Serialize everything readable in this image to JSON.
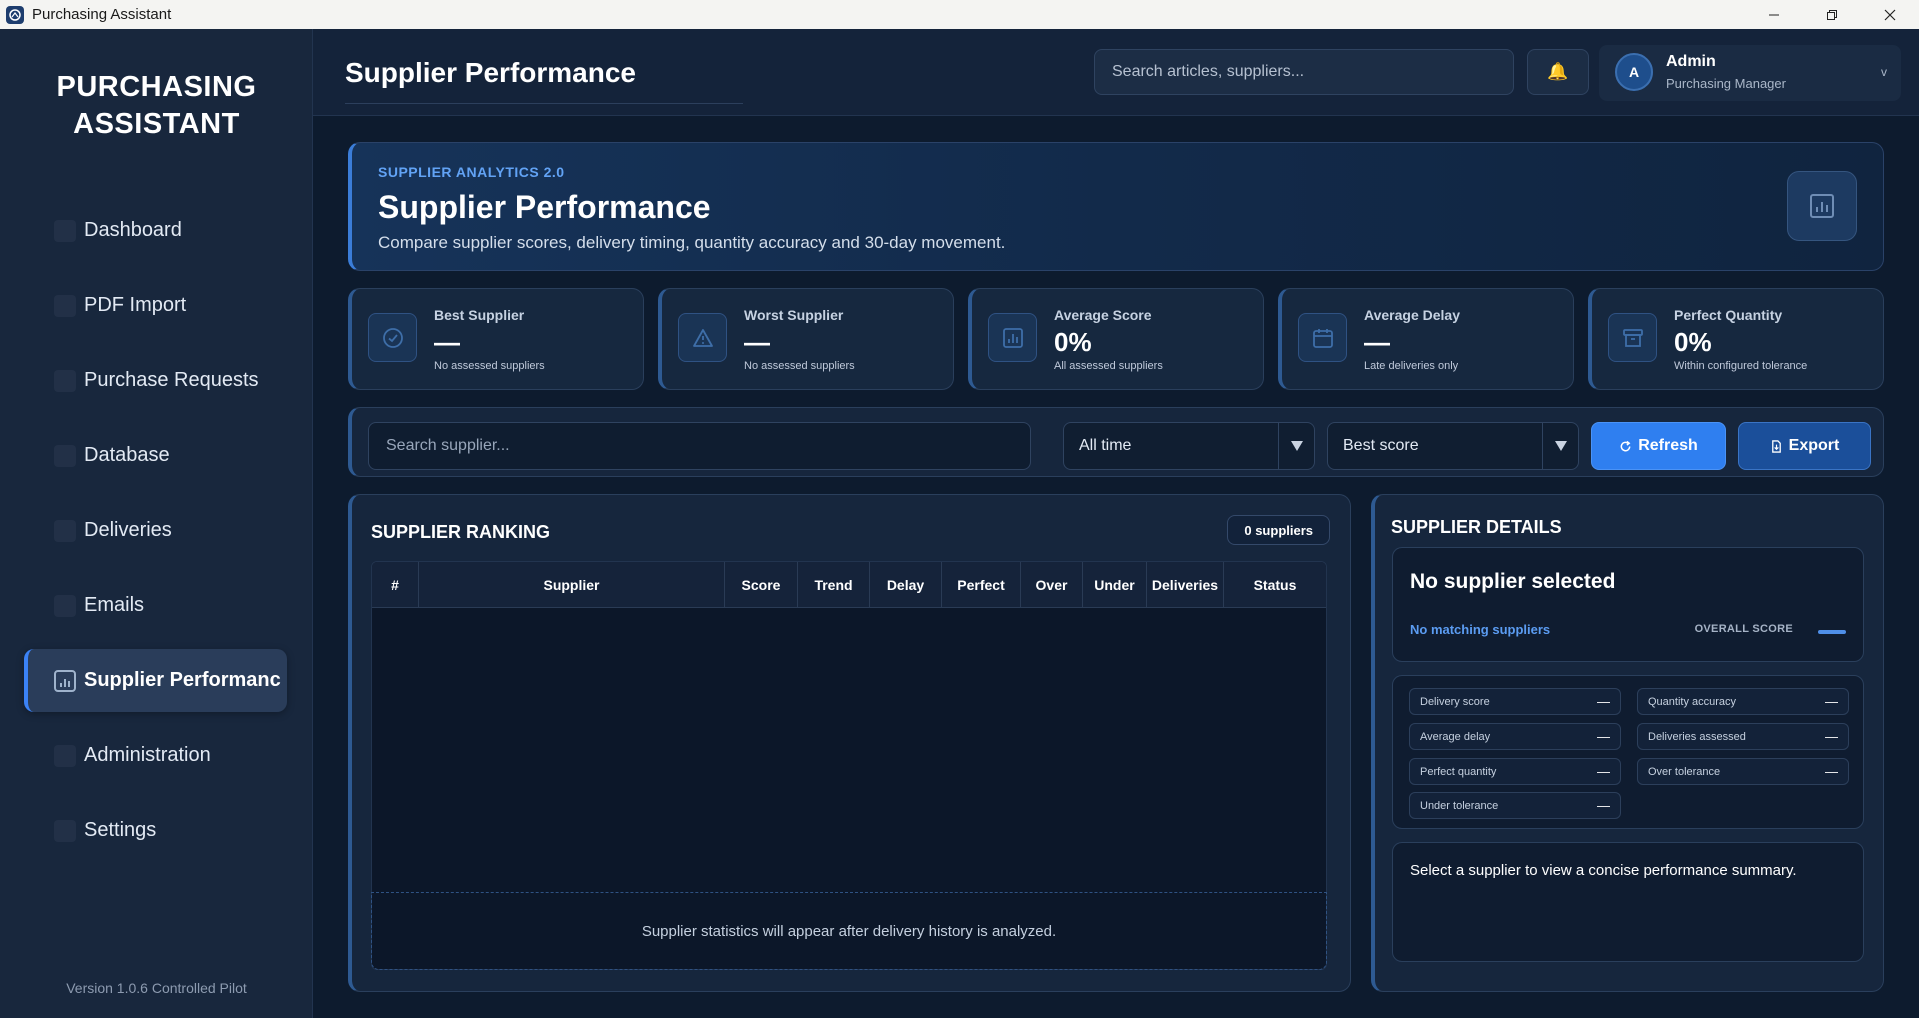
{
  "window": {
    "title": "Purchasing Assistant"
  },
  "sidebar": {
    "brand_line1": "PURCHASING",
    "brand_line2": "ASSISTANT",
    "items": [
      {
        "label": "Dashboard"
      },
      {
        "label": "PDF Import"
      },
      {
        "label": "Purchase Requests"
      },
      {
        "label": "Database"
      },
      {
        "label": "Deliveries"
      },
      {
        "label": "Emails"
      },
      {
        "label": "Supplier Performanc",
        "active": true
      },
      {
        "label": "Administration"
      },
      {
        "label": "Settings"
      }
    ],
    "version": "Version 1.0.6 Controlled Pilot"
  },
  "header": {
    "title": "Supplier Performance",
    "search_placeholder": "Search articles, suppliers...",
    "bell_icon": "bell-icon",
    "user": {
      "initial": "A",
      "name": "Admin",
      "role": "Purchasing Manager",
      "chevron": "v"
    }
  },
  "hero": {
    "eyebrow": "SUPPLIER ANALYTICS 2.0",
    "title": "Supplier Performance",
    "subtitle": "Compare supplier scores, delivery timing, quantity accuracy and 30-day movement."
  },
  "stats": [
    {
      "label": "Best Supplier",
      "value": "—",
      "note": "No assessed suppliers",
      "icon": "check-circle-icon"
    },
    {
      "label": "Worst Supplier",
      "value": "—",
      "note": "No assessed suppliers",
      "icon": "warning-icon"
    },
    {
      "label": "Average Score",
      "value": "0%",
      "note": "All assessed suppliers",
      "icon": "chart-icon"
    },
    {
      "label": "Average Delay",
      "value": "—",
      "note": "Late deliveries only",
      "icon": "calendar-icon"
    },
    {
      "label": "Perfect Quantity",
      "value": "0%",
      "note": "Within configured tolerance",
      "icon": "box-icon"
    }
  ],
  "filters": {
    "search_placeholder": "Search supplier...",
    "period": "All time",
    "sort": "Best score",
    "refresh_label": "Refresh",
    "export_label": "Export"
  },
  "ranking": {
    "title": "SUPPLIER RANKING",
    "count": "0 suppliers",
    "columns": [
      "#",
      "Supplier",
      "Score",
      "Trend",
      "Delay",
      "Perfect",
      "Over",
      "Under",
      "Deliveries",
      "Status"
    ],
    "empty_text": "Supplier statistics will appear after delivery history is analyzed."
  },
  "details": {
    "title": "SUPPLIER DETAILS",
    "selected_name": "No supplier selected",
    "selected_sub": "No matching suppliers",
    "overall_label": "OVERALL SCORE",
    "metrics": [
      {
        "label": "Delivery score",
        "value": "—"
      },
      {
        "label": "Quantity accuracy",
        "value": "—"
      },
      {
        "label": "Average delay",
        "value": "—"
      },
      {
        "label": "Deliveries assessed",
        "value": "—"
      },
      {
        "label": "Perfect quantity",
        "value": "—"
      },
      {
        "label": "Over tolerance",
        "value": "—"
      },
      {
        "label": "Under tolerance",
        "value": "—"
      }
    ],
    "summary": "Select a supplier to view a concise performance summary."
  },
  "colors": {
    "accent": "#3b82f6",
    "background": "#0d1b2e",
    "sidebar": "#18273d"
  }
}
